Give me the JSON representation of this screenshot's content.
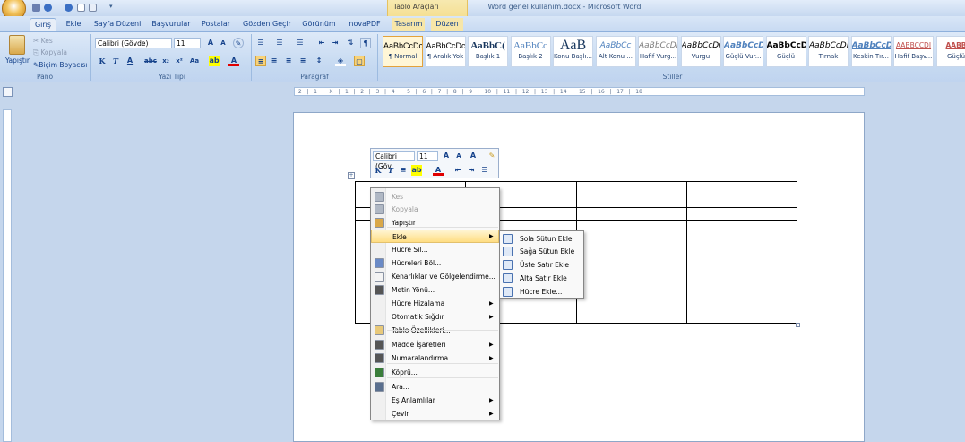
{
  "window": {
    "title": "Word genel kullanım.docx - Microsoft Word",
    "contextual_group": "Tablo Araçları"
  },
  "tabs": [
    "Giriş",
    "Ekle",
    "Sayfa Düzeni",
    "Başvurular",
    "Postalar",
    "Gözden Geçir",
    "Görünüm",
    "novaPDF",
    "Tasarım",
    "Düzen"
  ],
  "clipboard": {
    "paste": "Yapıştır",
    "cut": "Kes",
    "copy": "Kopyala",
    "format_painter": "Biçim Boyacısı",
    "group": "Pano"
  },
  "font": {
    "name": "Calibri (Gövde)",
    "size": "11",
    "group": "Yazı Tipi"
  },
  "paragraph": {
    "group": "Paragraf"
  },
  "styles": {
    "group": "Stiller",
    "items": [
      {
        "sample": "AaBbCcDc",
        "name": "¶ Normal"
      },
      {
        "sample": "AaBbCcDc",
        "name": "¶ Aralık Yok"
      },
      {
        "sample": "AaBbC(",
        "name": "Başlık 1"
      },
      {
        "sample": "AaBbCc",
        "name": "Başlık 2"
      },
      {
        "sample": "AaB",
        "name": "Konu Başlı..."
      },
      {
        "sample": "AaBbCc",
        "name": "Alt Konu ..."
      },
      {
        "sample": "AaBbCcDı",
        "name": "Hafif Vurg..."
      },
      {
        "sample": "AaBbCcDı",
        "name": "Vurgu"
      },
      {
        "sample": "AaBbCcDı",
        "name": "Güçlü Vur..."
      },
      {
        "sample": "AaBbCcDı",
        "name": "Güçlü"
      },
      {
        "sample": "AaBbCcDı",
        "name": "Tırnak"
      },
      {
        "sample": "AaBbCcDı",
        "name": "Keskin Tır..."
      },
      {
        "sample": "AABBCCDI",
        "name": "Hafif Başv..."
      },
      {
        "sample": "AABB",
        "name": "Güçlü"
      }
    ]
  },
  "ruler": {
    "ticks": "· 2 · | · 1 · | · X · | · 1 · | · 2 · | · 3 · | · 4 · | · 5 · | · 6 · | · 7 · | · 8 · | · 9 · | · 10 · | · 11 · | · 12 · | · 13 · | · 14 · | · 15 · | · 16 · | · 17 · | · 18 ·"
  },
  "mini_toolbar": {
    "font": "Calibri (Göv",
    "size": "11"
  },
  "context_menu": {
    "items": [
      {
        "label": "Kes",
        "disabled": true
      },
      {
        "label": "Kopyala",
        "disabled": true
      },
      {
        "label": "Yapıştır"
      },
      {
        "label": "Ekle",
        "submenu": true,
        "highlighted": true
      },
      {
        "label": "Hücre Sil..."
      },
      {
        "label": "Hücreleri Böl..."
      },
      {
        "label": "Kenarlıklar ve Gölgelendirme..."
      },
      {
        "label": "Metin Yönü..."
      },
      {
        "label": "Hücre Hizalama",
        "submenu": true
      },
      {
        "label": "Otomatik Sığdır",
        "submenu": true
      },
      {
        "label": "Tablo Özellikleri..."
      },
      {
        "label": "Madde İşaretleri",
        "submenu": true
      },
      {
        "label": "Numaralandırma",
        "submenu": true
      },
      {
        "label": "Köprü..."
      },
      {
        "label": "Ara..."
      },
      {
        "label": "Eş Anlamlılar",
        "submenu": true
      },
      {
        "label": "Çevir",
        "submenu": true
      }
    ]
  },
  "insert_submenu": {
    "items": [
      "Sola Sütun Ekle",
      "Sağa Sütun Ekle",
      "Üste Satır Ekle",
      "Alta Satır Ekle",
      "Hücre Ekle..."
    ]
  },
  "colors": {
    "ribbon": "#c5d9f1",
    "highlight": "#ffdd83",
    "table_tools": "#f3d77c"
  }
}
